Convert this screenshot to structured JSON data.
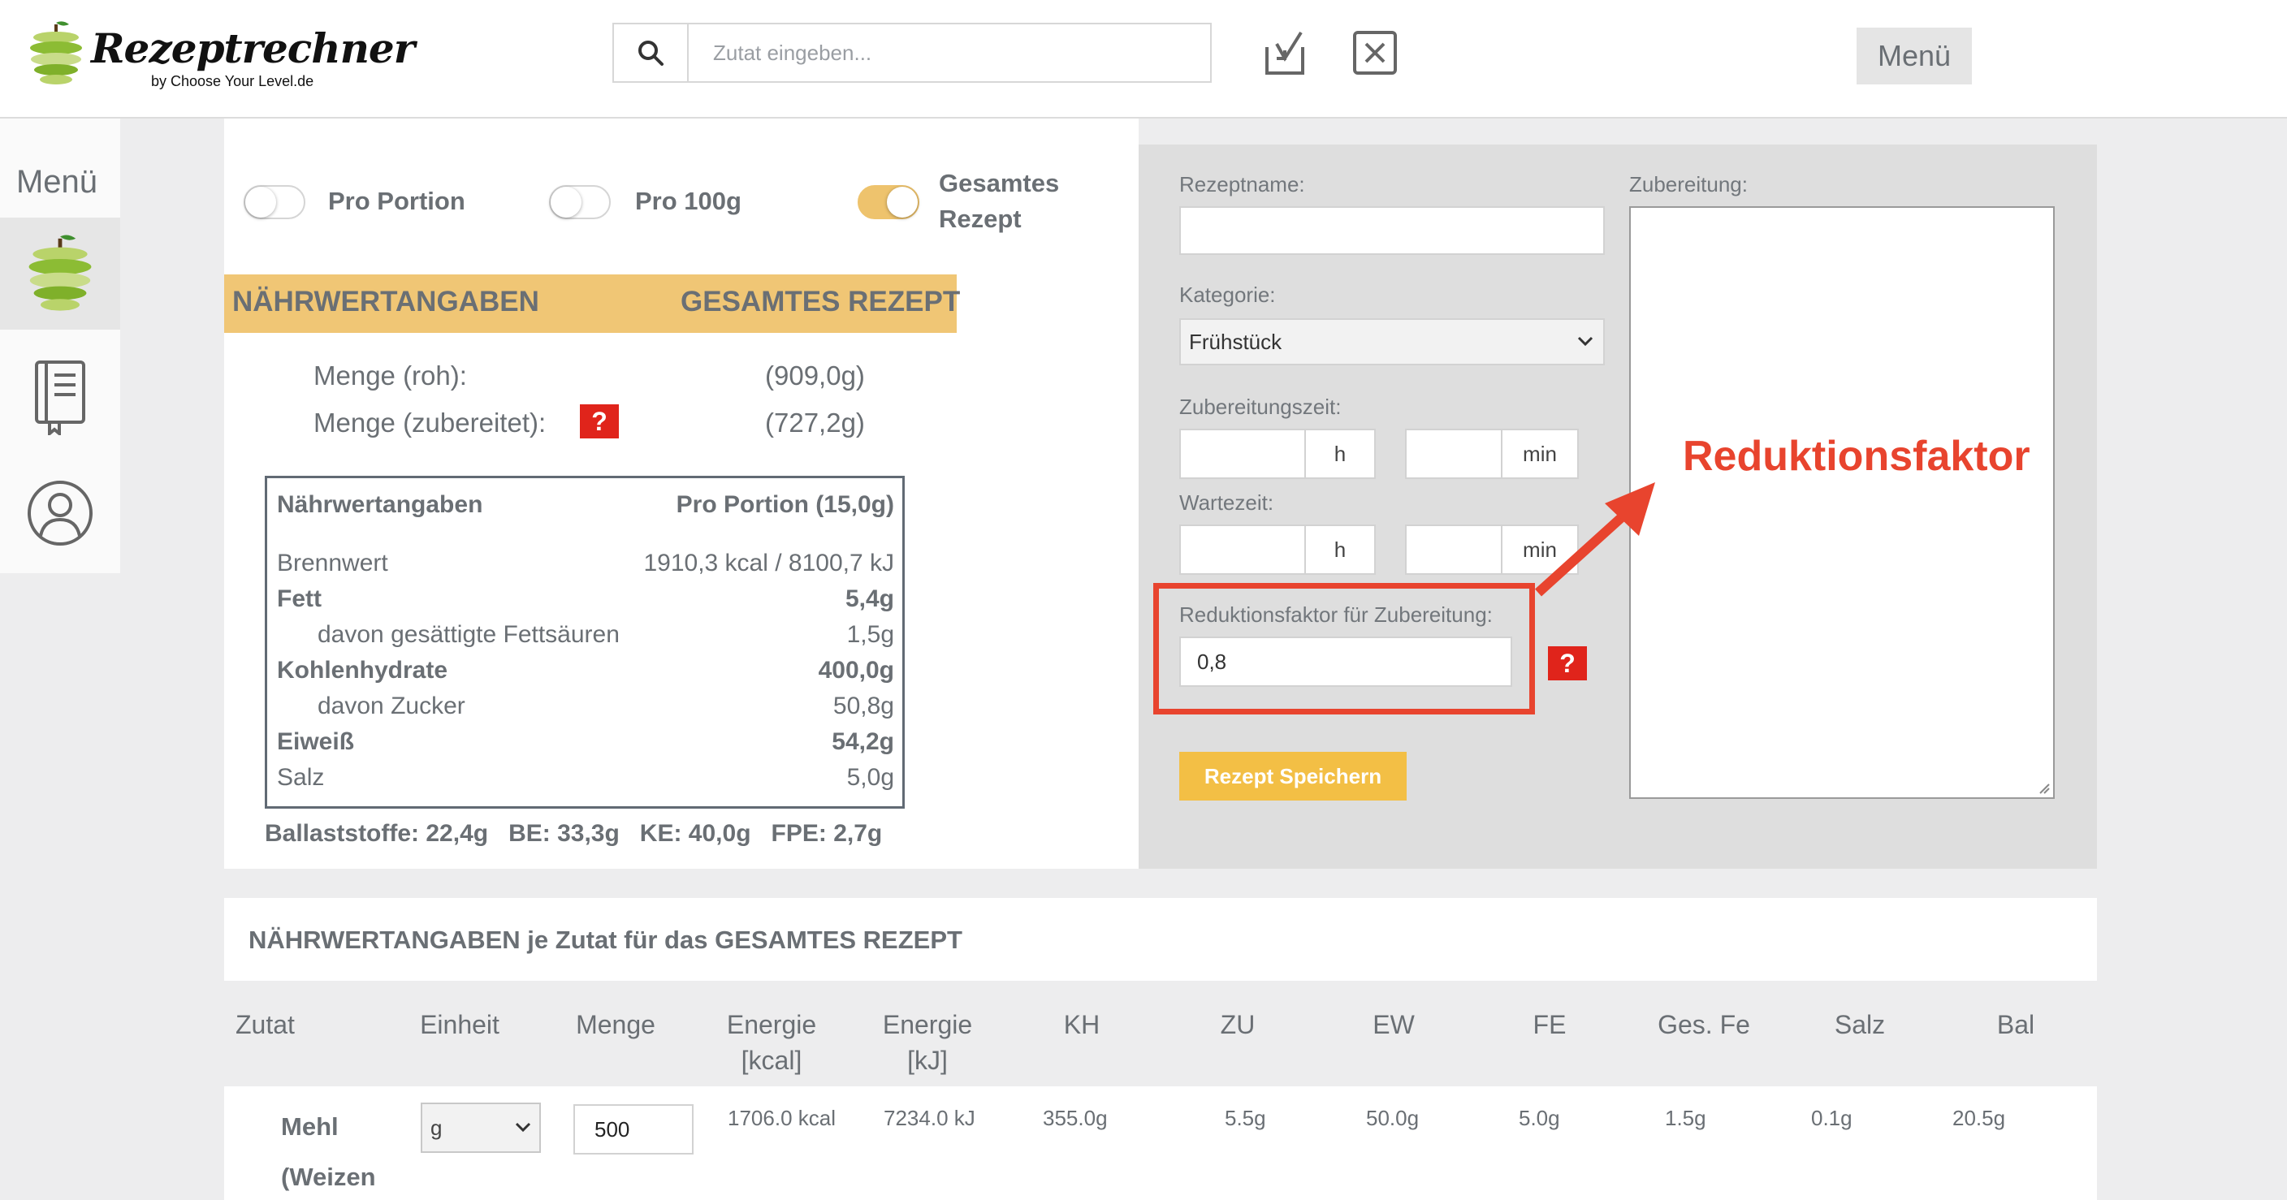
{
  "header": {
    "logo_title": "Rezeptrechner",
    "logo_subtitle": "by Choose Your Level.de",
    "search_placeholder": "Zutat eingeben...",
    "menu_label": "Menü"
  },
  "sidebar": {
    "menu_label": "Menü",
    "items": [
      {
        "icon": "apple-logo-icon"
      },
      {
        "icon": "book-icon"
      },
      {
        "icon": "user-icon"
      }
    ]
  },
  "toggles": [
    {
      "label": "Pro Portion",
      "on": false
    },
    {
      "label": "Pro 100g",
      "on": false
    },
    {
      "label_line1": "Gesamtes",
      "label_line2": "Rezept",
      "on": true
    }
  ],
  "nutrition_header": {
    "left": "NÄHRWERTANGABEN",
    "right": "GESAMTES REZEPT"
  },
  "menge": {
    "roh_label": "Menge (roh):",
    "roh_value": "(909,0g)",
    "zub_label": "Menge (zubereitet):",
    "zub_value": "(727,2g)",
    "help": "?"
  },
  "nutrition_table": {
    "header_left": "Nährwertangaben",
    "header_right": "Pro Portion (15,0g)",
    "rows": [
      {
        "label": "Brennwert",
        "value": "1910,3 kcal / 8100,7 kJ"
      },
      {
        "label": "Fett",
        "value": "5,4g"
      },
      {
        "label": "davon gesättigte Fettsäuren",
        "value": "1,5g"
      },
      {
        "label": "Kohlenhydrate",
        "value": "400,0g"
      },
      {
        "label": "davon Zucker",
        "value": "50,8g"
      },
      {
        "label": "Eiweiß",
        "value": "54,2g"
      },
      {
        "label": "Salz",
        "value": "5,0g"
      }
    ]
  },
  "ballast_line": "Ballaststoffe: 22,4g   BE: 33,3g   KE: 40,0g   FPE: 2,7g",
  "form": {
    "rezeptname_label": "Rezeptname:",
    "rezeptname_value": "",
    "kategorie_label": "Kategorie:",
    "kategorie_value": "Frühstück",
    "zubereitungszeit_label": "Zubereitungszeit:",
    "wartezeit_label": "Wartezeit:",
    "unit_h": "h",
    "unit_min": "min",
    "reduktion_label": "Reduktionsfaktor für Zubereitung:",
    "reduktion_value": "0,8",
    "help": "?",
    "zubereitung_label": "Zubereitung:",
    "save_label": "Rezept Speichern"
  },
  "annotation": {
    "text": "Reduktionsfaktor",
    "color": "#e8442e"
  },
  "bottom": {
    "title": "NÄHRWERTANGABEN je Zutat für das GESAMTES REZEPT",
    "columns": [
      "Zutat",
      "Einheit",
      "Menge",
      "Energie [kcal]",
      "Energie [kJ]",
      "KH",
      "ZU",
      "EW",
      "FE",
      "Ges. Fe",
      "Salz",
      "Bal"
    ],
    "row": {
      "zutat_line1": "Mehl",
      "zutat_line2": "(Weizen",
      "einheit": "g",
      "menge": "500",
      "kcal": "1706.0 kcal",
      "kj": "7234.0 kJ",
      "kh": "355.0g",
      "zu": "5.5g",
      "ew": "50.0g",
      "fe": "5.0g",
      "gesfe": "1.5g",
      "salz": "0.1g",
      "bal": "20.5g"
    }
  },
  "colors": {
    "accent": "#f0c675",
    "button": "#f3bf45",
    "alert": "#e0241b",
    "text": "#6a6f74"
  }
}
